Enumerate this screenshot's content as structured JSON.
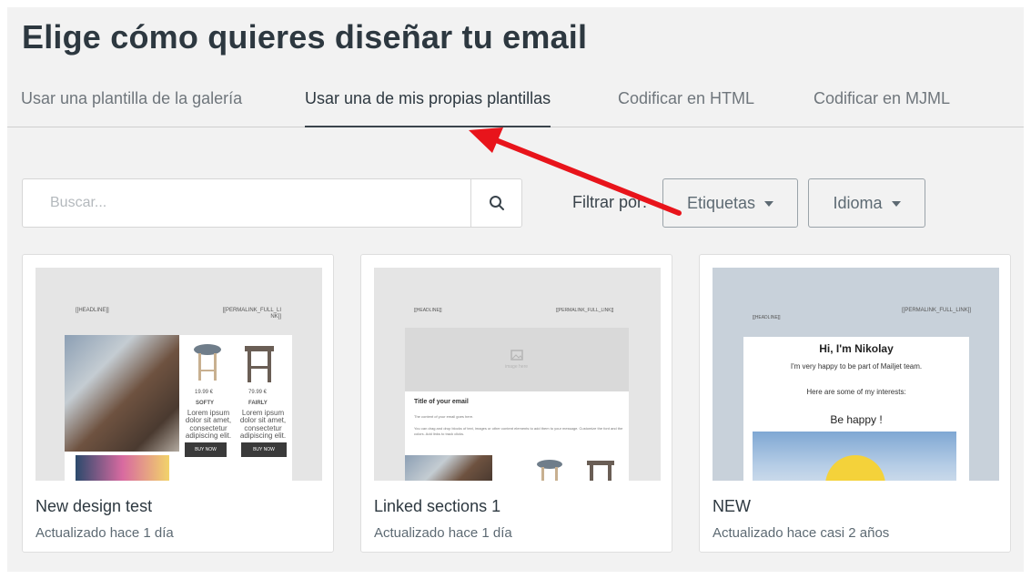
{
  "header": {
    "title": "Elige cómo quieres diseñar tu email"
  },
  "tabs": [
    {
      "label": "Usar una plantilla de la galería"
    },
    {
      "label": "Usar una de mis propias plantillas",
      "active": true
    },
    {
      "label": "Codificar en HTML"
    },
    {
      "label": "Codificar en MJML"
    }
  ],
  "search": {
    "placeholder": "Buscar...",
    "value": "",
    "icon": "search-icon"
  },
  "filters": {
    "label": "Filtrar por:",
    "tags_label": "Etiquetas",
    "language_label": "Idioma"
  },
  "templates": [
    {
      "name": "New design test",
      "updated": "Actualizado hace 1 día",
      "preview": {
        "headline": "[[HEADLINE]]",
        "permalink": "[[PERMALINK_FULL_LI NK]]",
        "product1_price": "19.99 €",
        "product1_name": "SOFTY",
        "product1_text": "Lorem ipsum dolor sit amet, consectetur adipiscing elit.",
        "product1_button": "BUY NOW",
        "product2_price": "79.99 €",
        "product2_name": "FAIRLY",
        "product2_text": "Lorem ipsum dolor sit amet, consectetur adipiscing elit.",
        "product2_button": "BUY NOW"
      }
    },
    {
      "name": "Linked sections 1",
      "updated": "Actualizado hace 1 día",
      "preview": {
        "headline": "[[HEADLINE]]",
        "permalink": "[[PERMALINK_FULL_LINK]]",
        "image_placeholder": "image here",
        "email_title": "Title of your email",
        "line1": "The content of your email goes here.",
        "line2": "You can drag and drop blocks of text, images or other content elements to add them to your message. Customize the font and the colors. Add links to track clicks."
      }
    },
    {
      "name": "NEW",
      "updated": "Actualizado hace casi 2 años",
      "preview": {
        "headline": "[[HEADLINE]]",
        "permalink": "[[PERMALINK_FULL_LINK]]",
        "greeting": "Hi, I'm Nikolay",
        "intro": "I'm very happy to be part of Mailjet team.",
        "interests": "Here are some of my interests:",
        "happy": "Be happy !"
      }
    }
  ],
  "annotation": {
    "color": "#e8141b"
  }
}
